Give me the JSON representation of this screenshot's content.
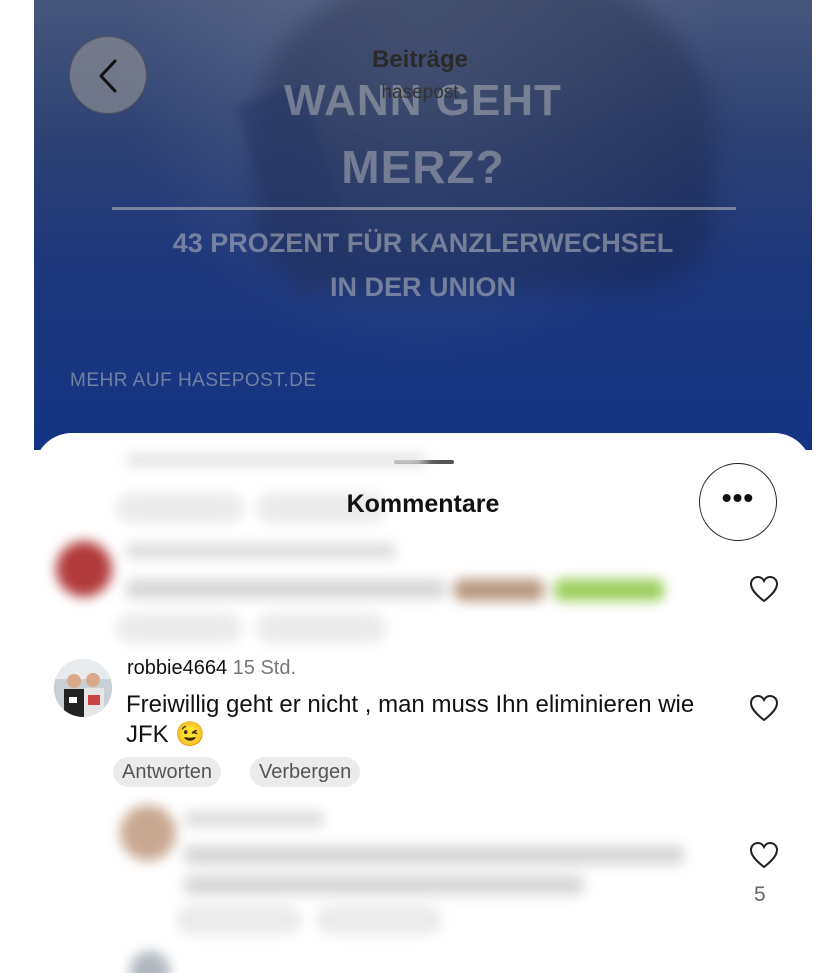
{
  "post": {
    "headline_line1": "WANN GEHT",
    "headline_line2": "MERZ?",
    "subline1": "43 PROZENT FÜR KANZLERWECHSEL",
    "subline2": "IN DER UNION",
    "more_link": "MEHR AUF HASEPOST.DE"
  },
  "nav": {
    "title": "Beiträge",
    "subtitle": "hasepost",
    "back_icon": "chevron-left-icon"
  },
  "comments_sheet": {
    "title": "Kommentare",
    "more_icon": "more-horizontal-icon",
    "more_label": "•••",
    "comment": {
      "username": "robbie4664",
      "time": "15 Std.",
      "text": "Freiwillig geht er nicht , man muss Ihn eliminieren wie JFK 😉",
      "reply_label": "Antworten",
      "hide_label": "Verbergen"
    },
    "reply_like_count": "5",
    "heart_icon": "heart-icon"
  }
}
